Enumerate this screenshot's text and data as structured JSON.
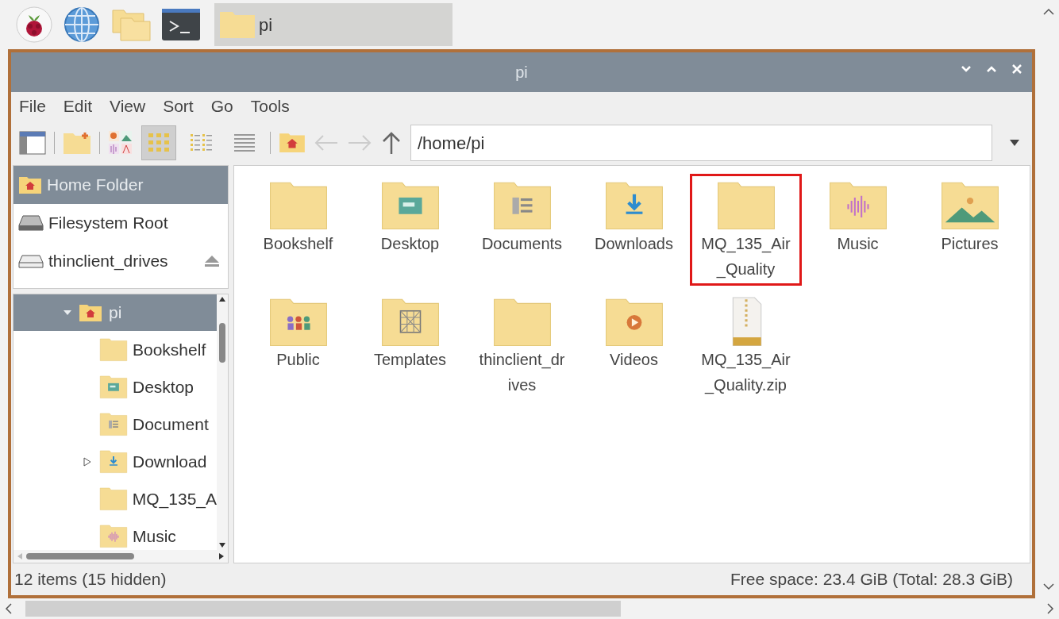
{
  "taskbar": {
    "task_button": {
      "label": "pi",
      "selected": true
    }
  },
  "window": {
    "title": "pi"
  },
  "menu": [
    "File",
    "Edit",
    "View",
    "Sort",
    "Go",
    "Tools"
  ],
  "toolbar": {
    "view_modes": [
      {
        "kind": "icons",
        "selected": true
      },
      {
        "kind": "compact",
        "selected": false
      },
      {
        "kind": "list",
        "selected": false
      }
    ],
    "path": "/home/pi"
  },
  "places": [
    {
      "label": "Home Folder",
      "kind": "home",
      "selected": true,
      "eject": false
    },
    {
      "label": "Filesystem Root",
      "kind": "disk",
      "selected": false,
      "eject": false
    },
    {
      "label": "thinclient_drives",
      "kind": "drive",
      "selected": false,
      "eject": true
    }
  ],
  "tree": {
    "label": "pi",
    "expanded": true,
    "selected": true,
    "children": [
      {
        "label": "Bookshelf",
        "kind": "plain",
        "expandable": false
      },
      {
        "label": "Desktop",
        "kind": "desktop",
        "expandable": false
      },
      {
        "label": "Document",
        "kind": "documents",
        "expandable": false
      },
      {
        "label": "Download",
        "kind": "downloads",
        "expandable": true
      },
      {
        "label": "MQ_135_A",
        "kind": "plain",
        "expandable": false
      },
      {
        "label": "Music",
        "kind": "music",
        "expandable": false
      }
    ]
  },
  "files": [
    {
      "label": "Bookshelf",
      "kind": "plain",
      "highlighted": false
    },
    {
      "label": "Desktop",
      "kind": "desktop",
      "highlighted": false
    },
    {
      "label": "Documents",
      "kind": "documents",
      "highlighted": false
    },
    {
      "label": "Downloads",
      "kind": "downloads",
      "highlighted": false
    },
    {
      "label": "MQ_135_Air _Quality",
      "kind": "plain",
      "highlighted": true
    },
    {
      "label": "Music",
      "kind": "music",
      "highlighted": false
    },
    {
      "label": "Pictures",
      "kind": "pictures",
      "highlighted": false
    },
    {
      "label": "Public",
      "kind": "public",
      "highlighted": false
    },
    {
      "label": "Templates",
      "kind": "templates",
      "highlighted": false
    },
    {
      "label": "thinclient_dr ives",
      "kind": "plain",
      "highlighted": false
    },
    {
      "label": "Videos",
      "kind": "videos",
      "highlighted": false
    },
    {
      "label": "MQ_135_Air _Quality.zip",
      "kind": "zip",
      "highlighted": false
    }
  ],
  "status_bar": {
    "left": "12 items (15 hidden)",
    "right": "Free space: 23.4 GiB (Total: 28.3 GiB)"
  }
}
